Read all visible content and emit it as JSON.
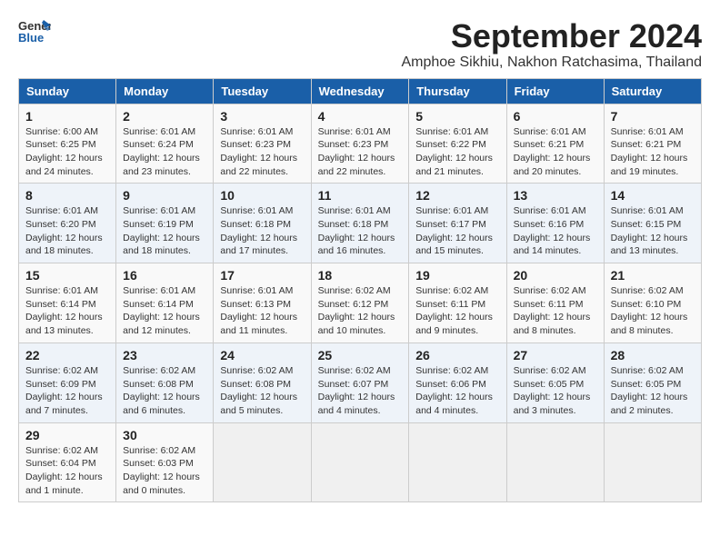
{
  "header": {
    "logo_general": "General",
    "logo_blue": "Blue",
    "title": "September 2024",
    "subtitle": "Amphoe Sikhiu, Nakhon Ratchasima, Thailand"
  },
  "weekdays": [
    "Sunday",
    "Monday",
    "Tuesday",
    "Wednesday",
    "Thursday",
    "Friday",
    "Saturday"
  ],
  "weeks": [
    [
      {
        "day": "1",
        "info": "Sunrise: 6:00 AM\nSunset: 6:25 PM\nDaylight: 12 hours\nand 24 minutes."
      },
      {
        "day": "2",
        "info": "Sunrise: 6:01 AM\nSunset: 6:24 PM\nDaylight: 12 hours\nand 23 minutes."
      },
      {
        "day": "3",
        "info": "Sunrise: 6:01 AM\nSunset: 6:23 PM\nDaylight: 12 hours\nand 22 minutes."
      },
      {
        "day": "4",
        "info": "Sunrise: 6:01 AM\nSunset: 6:23 PM\nDaylight: 12 hours\nand 22 minutes."
      },
      {
        "day": "5",
        "info": "Sunrise: 6:01 AM\nSunset: 6:22 PM\nDaylight: 12 hours\nand 21 minutes."
      },
      {
        "day": "6",
        "info": "Sunrise: 6:01 AM\nSunset: 6:21 PM\nDaylight: 12 hours\nand 20 minutes."
      },
      {
        "day": "7",
        "info": "Sunrise: 6:01 AM\nSunset: 6:21 PM\nDaylight: 12 hours\nand 19 minutes."
      }
    ],
    [
      {
        "day": "8",
        "info": "Sunrise: 6:01 AM\nSunset: 6:20 PM\nDaylight: 12 hours\nand 18 minutes."
      },
      {
        "day": "9",
        "info": "Sunrise: 6:01 AM\nSunset: 6:19 PM\nDaylight: 12 hours\nand 18 minutes."
      },
      {
        "day": "10",
        "info": "Sunrise: 6:01 AM\nSunset: 6:18 PM\nDaylight: 12 hours\nand 17 minutes."
      },
      {
        "day": "11",
        "info": "Sunrise: 6:01 AM\nSunset: 6:18 PM\nDaylight: 12 hours\nand 16 minutes."
      },
      {
        "day": "12",
        "info": "Sunrise: 6:01 AM\nSunset: 6:17 PM\nDaylight: 12 hours\nand 15 minutes."
      },
      {
        "day": "13",
        "info": "Sunrise: 6:01 AM\nSunset: 6:16 PM\nDaylight: 12 hours\nand 14 minutes."
      },
      {
        "day": "14",
        "info": "Sunrise: 6:01 AM\nSunset: 6:15 PM\nDaylight: 12 hours\nand 13 minutes."
      }
    ],
    [
      {
        "day": "15",
        "info": "Sunrise: 6:01 AM\nSunset: 6:14 PM\nDaylight: 12 hours\nand 13 minutes."
      },
      {
        "day": "16",
        "info": "Sunrise: 6:01 AM\nSunset: 6:14 PM\nDaylight: 12 hours\nand 12 minutes."
      },
      {
        "day": "17",
        "info": "Sunrise: 6:01 AM\nSunset: 6:13 PM\nDaylight: 12 hours\nand 11 minutes."
      },
      {
        "day": "18",
        "info": "Sunrise: 6:02 AM\nSunset: 6:12 PM\nDaylight: 12 hours\nand 10 minutes."
      },
      {
        "day": "19",
        "info": "Sunrise: 6:02 AM\nSunset: 6:11 PM\nDaylight: 12 hours\nand 9 minutes."
      },
      {
        "day": "20",
        "info": "Sunrise: 6:02 AM\nSunset: 6:11 PM\nDaylight: 12 hours\nand 8 minutes."
      },
      {
        "day": "21",
        "info": "Sunrise: 6:02 AM\nSunset: 6:10 PM\nDaylight: 12 hours\nand 8 minutes."
      }
    ],
    [
      {
        "day": "22",
        "info": "Sunrise: 6:02 AM\nSunset: 6:09 PM\nDaylight: 12 hours\nand 7 minutes."
      },
      {
        "day": "23",
        "info": "Sunrise: 6:02 AM\nSunset: 6:08 PM\nDaylight: 12 hours\nand 6 minutes."
      },
      {
        "day": "24",
        "info": "Sunrise: 6:02 AM\nSunset: 6:08 PM\nDaylight: 12 hours\nand 5 minutes."
      },
      {
        "day": "25",
        "info": "Sunrise: 6:02 AM\nSunset: 6:07 PM\nDaylight: 12 hours\nand 4 minutes."
      },
      {
        "day": "26",
        "info": "Sunrise: 6:02 AM\nSunset: 6:06 PM\nDaylight: 12 hours\nand 4 minutes."
      },
      {
        "day": "27",
        "info": "Sunrise: 6:02 AM\nSunset: 6:05 PM\nDaylight: 12 hours\nand 3 minutes."
      },
      {
        "day": "28",
        "info": "Sunrise: 6:02 AM\nSunset: 6:05 PM\nDaylight: 12 hours\nand 2 minutes."
      }
    ],
    [
      {
        "day": "29",
        "info": "Sunrise: 6:02 AM\nSunset: 6:04 PM\nDaylight: 12 hours\nand 1 minute."
      },
      {
        "day": "30",
        "info": "Sunrise: 6:02 AM\nSunset: 6:03 PM\nDaylight: 12 hours\nand 0 minutes."
      },
      null,
      null,
      null,
      null,
      null
    ]
  ]
}
